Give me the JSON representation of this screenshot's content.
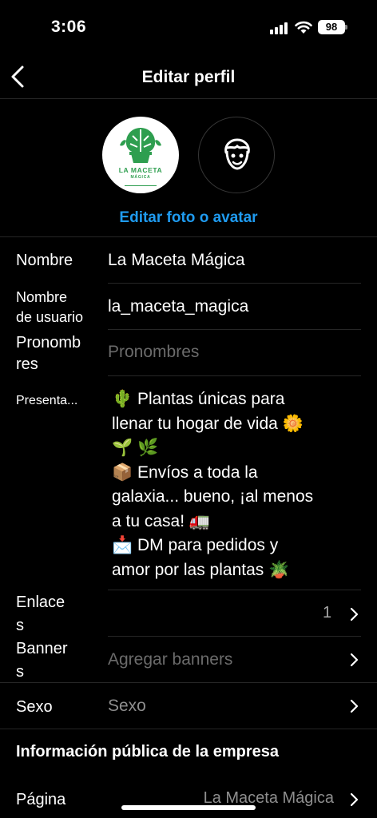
{
  "status_bar": {
    "time": "3:06",
    "battery": "98"
  },
  "nav": {
    "title": "Editar perfil"
  },
  "avatar": {
    "brand_line1": "LA MACETA",
    "brand_line2": "MÁGICA",
    "edit_label": "Editar foto o avatar"
  },
  "fields": {
    "name": {
      "label": "Nombre",
      "value": "La Maceta Mágica"
    },
    "username": {
      "label_line1": "Nombre",
      "label_line2": "de usuario",
      "value": "la_maceta_magica"
    },
    "pronouns": {
      "label_line1": "Pronomb",
      "label_line2": "res",
      "placeholder": "Pronombres"
    },
    "bio": {
      "label": "Presenta...",
      "value": "🌵 Plantas únicas para\nllenar tu hogar de vida 🌼\n🌱 🌿\n📦 Envíos a toda la\ngalaxia... bueno, ¡al menos\na tu casa! 🚛\n📩 DM para pedidos y\namor por las plantas 🪴"
    },
    "links": {
      "label_line1": "Enlace",
      "label_line2": "s",
      "count": "1"
    },
    "banners": {
      "label_line1": "Banner",
      "label_line2": "s",
      "placeholder": "Agregar banners"
    },
    "gender": {
      "label": "Sexo",
      "placeholder": "Sexo"
    }
  },
  "business": {
    "section_title": "Información pública de la empresa",
    "page": {
      "label": "Página",
      "value": "La Maceta Mágica"
    }
  },
  "colors": {
    "accent": "#1f9bf0",
    "background": "#000000",
    "brand_green": "#2e9e4f"
  }
}
